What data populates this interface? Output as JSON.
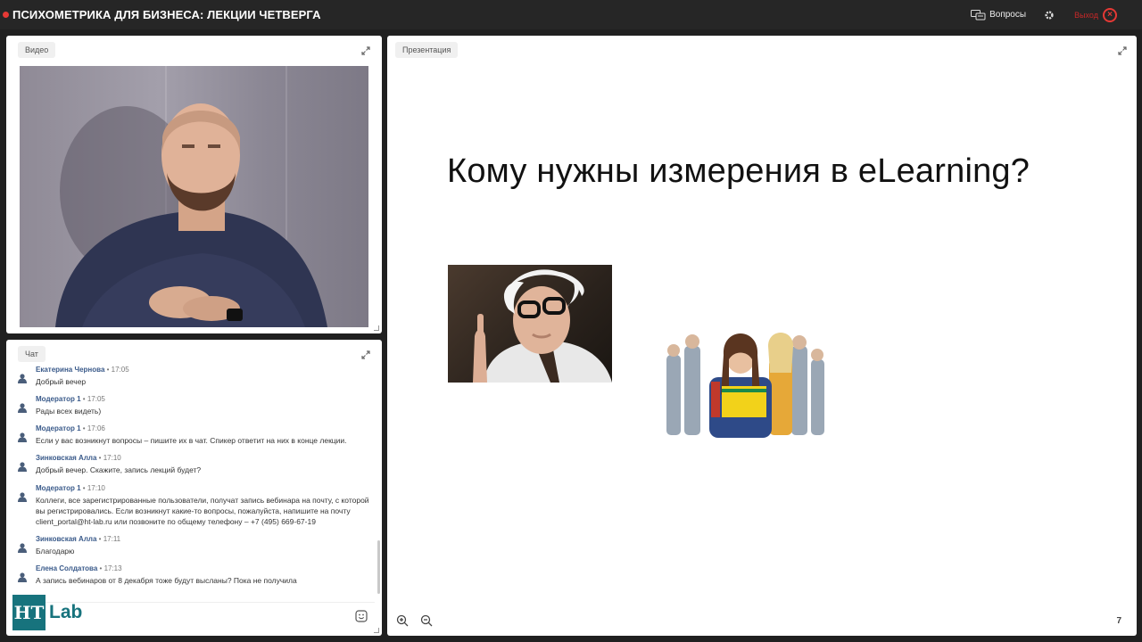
{
  "header": {
    "title": "ПСИХОМЕТРИКА ДЛЯ БИЗНЕСА: ЛЕКЦИИ ЧЕТВЕРГА",
    "questions_label": "Вопросы",
    "exit_label": "Выход"
  },
  "video": {
    "label": "Видео"
  },
  "chat": {
    "label": "Чат",
    "messages": [
      {
        "author": "Екатерина Чернова",
        "time": "17:05",
        "text": "Добрый вечер"
      },
      {
        "author": "Модератор 1",
        "time": "17:05",
        "text": "Рады всех видеть)"
      },
      {
        "author": "Модератор 1",
        "time": "17:06",
        "text": "Если у вас возникнут вопросы – пишите их в чат. Спикер ответит на них в конце лекции."
      },
      {
        "author": "Зинковская Алла",
        "time": "17:10",
        "text": "Добрый вечер. Скажите, запись лекций будет?"
      },
      {
        "author": "Модератор 1",
        "time": "17:10",
        "text": "Коллеги, все зарегистрированные пользователи, получат запись вебинара на почту, с которой вы регистрировались. Если возникнут какие-то вопросы, пожалуйста, напишите на почту client_portal@ht-lab.ru или позвоните по общему телефону – +7 (495) 669-67-19"
      },
      {
        "author": "Зинковская Алла",
        "time": "17:11",
        "text": "Благодарю"
      },
      {
        "author": "Елена Солдатова",
        "time": "17:13",
        "text": "А запись вебинаров от 8 декабря тоже будут высланы? Пока не получила"
      }
    ]
  },
  "logo": {
    "mark": "HT",
    "text": "Lab"
  },
  "presentation": {
    "label": "Презентация",
    "slide_title": "Кому нужны измерения в eLearning?",
    "page_number": "7"
  },
  "colors": {
    "accent": "#17737d",
    "exit": "#e53935",
    "author": "#3a5a8a"
  }
}
